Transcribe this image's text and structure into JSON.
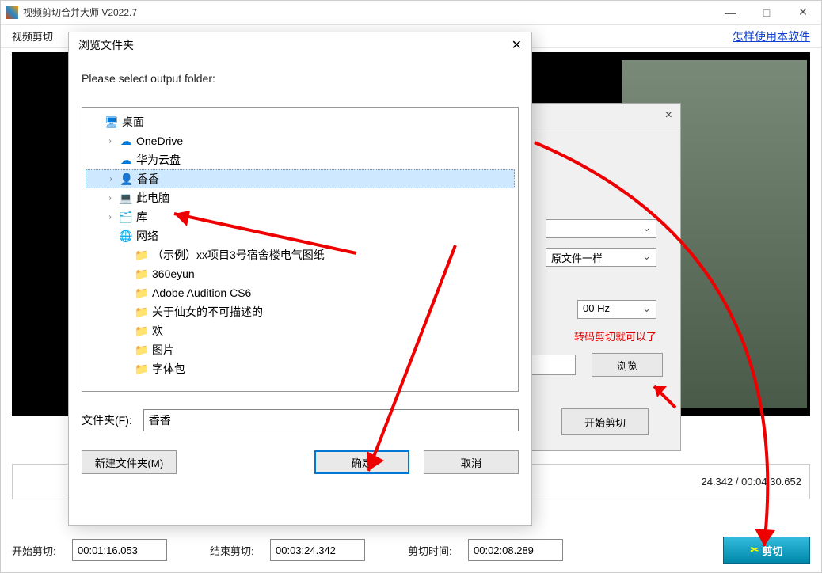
{
  "window": {
    "title": "视频剪切合并大师 V2022.7",
    "helplink": "怎样使用本软件",
    "tab_label": "视频剪切"
  },
  "bg_dialog": {
    "close": "×",
    "option_same": "原文件一样",
    "option_hz": "00 Hz",
    "red_text": "转码剪切就可以了",
    "browse": "浏览",
    "start": "开始剪切"
  },
  "folder_dialog": {
    "title": "浏览文件夹",
    "prompt": "Please select output folder:",
    "tree": {
      "root": "桌面",
      "items": [
        {
          "label": "OneDrive",
          "icon": "onedrive",
          "expandable": true
        },
        {
          "label": "华为云盘",
          "icon": "cloud",
          "expandable": false
        },
        {
          "label": "香香",
          "icon": "user",
          "expandable": true,
          "selected": true
        },
        {
          "label": "此电脑",
          "icon": "pc",
          "expandable": true
        },
        {
          "label": "库",
          "icon": "lib",
          "expandable": true
        },
        {
          "label": "网络",
          "icon": "net",
          "expandable": false
        }
      ],
      "folders": [
        "（示例）xx项目3号宿舍楼电气图纸",
        "360eyun",
        "Adobe Audition CS6",
        "关于仙女的不可描述的",
        "欢",
        "图片",
        "字体包"
      ]
    },
    "folder_label": "文件夹(F):",
    "folder_value": "香香",
    "new_folder": "新建文件夹(M)",
    "ok": "确定",
    "cancel": "取消"
  },
  "timeline": {
    "display": "24.342 / 00:04:30.652"
  },
  "bottom": {
    "start_label": "开始剪切:",
    "start_value": "00:01:16.053",
    "end_label": "结束剪切:",
    "end_value": "00:03:24.342",
    "dur_label": "剪切时间:",
    "dur_value": "00:02:08.289",
    "cut_btn": "剪切"
  }
}
